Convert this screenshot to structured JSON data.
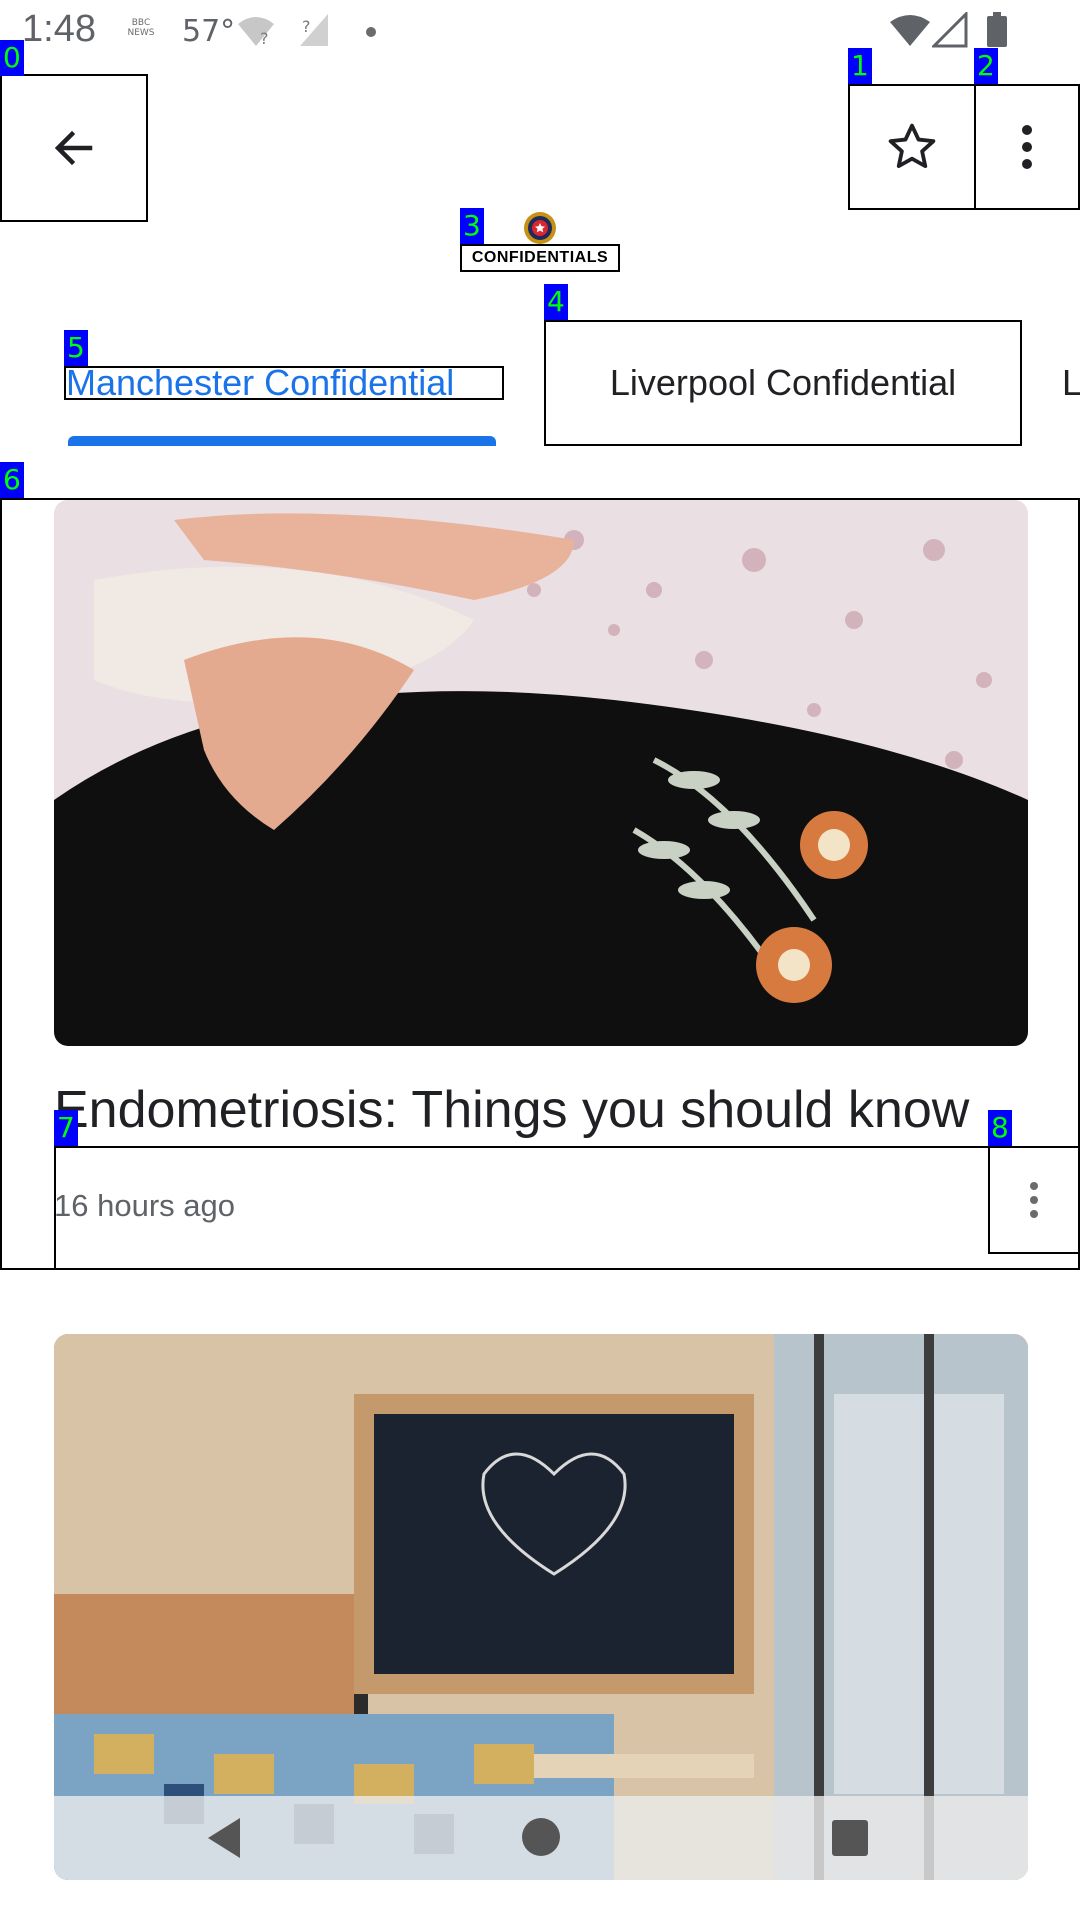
{
  "status_bar": {
    "time": "1:48",
    "news_badge": "BBC NEWS",
    "temperature": "57°"
  },
  "app_bar": {
    "logo_text": "CONFIDENTIALS"
  },
  "tabs": [
    {
      "label": "Manchester Confidential",
      "selected": true
    },
    {
      "label": "Liverpool Confidential",
      "selected": false
    },
    {
      "label": "L",
      "selected": false
    }
  ],
  "articles": [
    {
      "title": "Endometriosis: Things you should know",
      "time": "16 hours ago"
    }
  ],
  "annotations": [
    "0",
    "1",
    "2",
    "3",
    "4",
    "5",
    "6",
    "7",
    "8"
  ],
  "colors": {
    "accent": "#1a73e8",
    "tag_bg": "#0000ff",
    "tag_text": "#00ff00"
  }
}
